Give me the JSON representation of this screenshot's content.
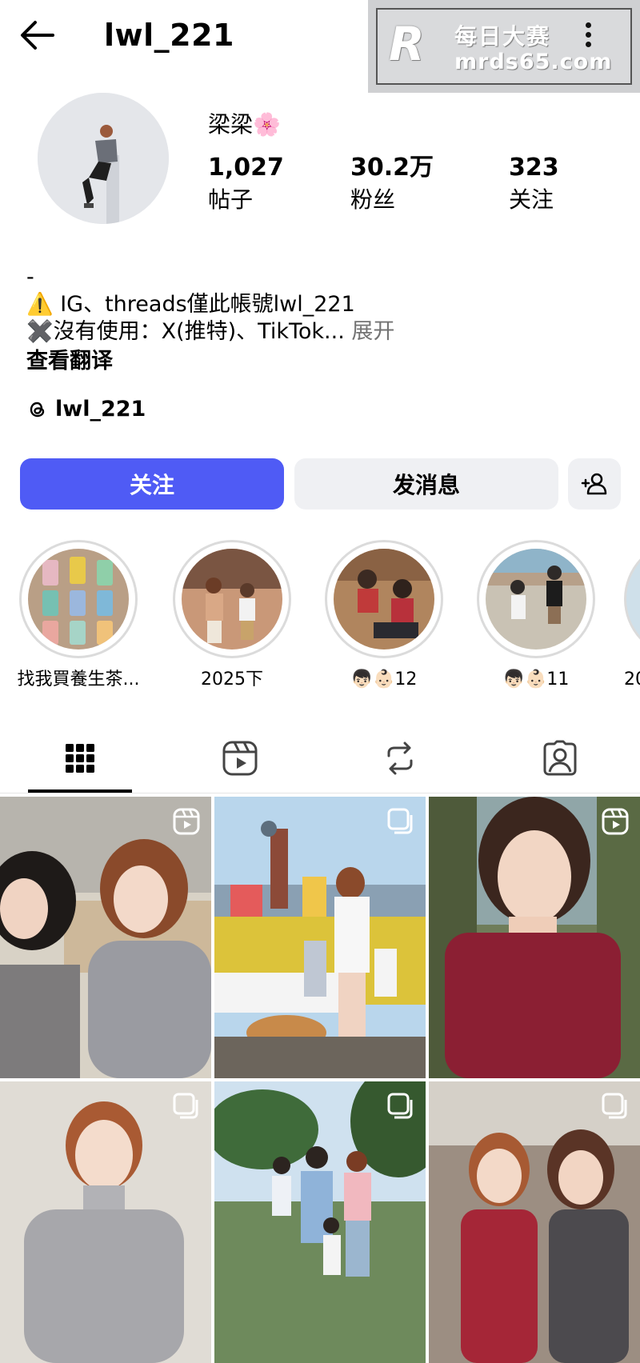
{
  "header": {
    "username": "lwl_221",
    "back_icon": "arrow-left-icon",
    "more_icon": "more-vertical-icon"
  },
  "watermark": {
    "logo": "R",
    "line1": "每日大赛",
    "line2": "mrds65.com"
  },
  "profile": {
    "display_name": "梁梁🌸",
    "stats": [
      {
        "value": "1,027",
        "label": "帖子"
      },
      {
        "value": "30.2万",
        "label": "粉丝"
      },
      {
        "value": "323",
        "label": "关注"
      }
    ],
    "bio": {
      "line1": "-",
      "line2": "⚠️ IG、threads僅此帳號lwl_221",
      "line3": "✖️沒有使用：X(推特)、TikTok...",
      "expand": "展开"
    },
    "translate_label": "查看翻译",
    "threads_handle": "lwl_221"
  },
  "actions": {
    "follow": "关注",
    "message": "发消息",
    "add_person_icon": "add-person-icon"
  },
  "highlights": [
    {
      "label": "找我買養生茶..."
    },
    {
      "label": "2025下"
    },
    {
      "label": "👦🏻👶🏻12"
    },
    {
      "label": "👦🏻👶🏻11"
    },
    {
      "label": "20"
    }
  ],
  "tabs": [
    {
      "name": "grid-icon"
    },
    {
      "name": "reels-icon"
    },
    {
      "name": "reposts-icon"
    },
    {
      "name": "tagged-icon"
    }
  ],
  "colors": {
    "accent": "#4f5bf5",
    "button_bg": "#eff0f3",
    "muted_text": "#737373"
  }
}
